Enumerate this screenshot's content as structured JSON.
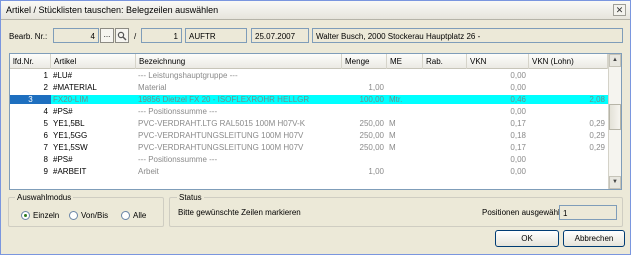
{
  "window": {
    "title": "Artikel / Stücklisten tauschen: Belegzeilen auswählen",
    "close_glyph": "✕"
  },
  "header": {
    "bearb_label": "Bearb. Nr.:",
    "bearb_nr": "4",
    "browse_glyph": "...",
    "search_icon": "magnifier-icon",
    "slash": "/",
    "pos_nr": "1",
    "beleg_type": "AUFTR",
    "date": "25.07.2007",
    "customer": "Walter Busch, 2000  Stockerau Hauptplatz 26 -"
  },
  "table": {
    "columns": [
      "lfd.Nr.",
      "Artikel",
      "Bezeichnung",
      "Menge",
      "ME",
      "Rab.",
      "VKN",
      "VKN (Lohn)"
    ],
    "rows": [
      {
        "nr": "1",
        "artikel": "#LU#",
        "bez": "--- Leistungshauptgruppe ---",
        "menge": "",
        "me": "",
        "rab": "",
        "vkn": "0,00",
        "lohn": "",
        "selected": false
      },
      {
        "nr": "2",
        "artikel": "#MATERIAL",
        "bez": "Material",
        "menge": "1,00",
        "me": "",
        "rab": "",
        "vkn": "0,00",
        "lohn": "",
        "selected": false
      },
      {
        "nr": "3",
        "artikel": "FX20-LIM",
        "bez": "19856 Dietzel FX 20 - ISOFLEXROHR HELLGR",
        "menge": "100,00",
        "me": "Mtr.",
        "rab": "",
        "vkn": "0,46",
        "lohn": "2,08",
        "selected": true
      },
      {
        "nr": "4",
        "artikel": "#PS#",
        "bez": "--- Positionssumme ---",
        "menge": "",
        "me": "",
        "rab": "",
        "vkn": "0,00",
        "lohn": "",
        "selected": false
      },
      {
        "nr": "5",
        "artikel": "YE1,5BL",
        "bez": "PVC-VERDRAHT.LTG RAL5015  100M H07V-K",
        "menge": "250,00",
        "me": "M",
        "rab": "",
        "vkn": "0,17",
        "lohn": "0,29",
        "selected": false
      },
      {
        "nr": "6",
        "artikel": "YE1,5GG",
        "bez": "PVC-VERDRAHTUNGSLEITUNG  100M H07V",
        "menge": "250,00",
        "me": "M",
        "rab": "",
        "vkn": "0,18",
        "lohn": "0,29",
        "selected": false
      },
      {
        "nr": "7",
        "artikel": "YE1,5SW",
        "bez": "PVC-VERDRAHTUNGSLEITUNG  100M H07V",
        "menge": "250,00",
        "me": "M",
        "rab": "",
        "vkn": "0,17",
        "lohn": "0,29",
        "selected": false
      },
      {
        "nr": "8",
        "artikel": "#PS#",
        "bez": "--- Positionssumme ---",
        "menge": "",
        "me": "",
        "rab": "",
        "vkn": "0,00",
        "lohn": "",
        "selected": false
      },
      {
        "nr": "9",
        "artikel": "#ARBEIT",
        "bez": "Arbeit",
        "menge": "1,00",
        "me": "",
        "rab": "",
        "vkn": "0,00",
        "lohn": "",
        "selected": false
      }
    ]
  },
  "auswahlmodus": {
    "label": "Auswahlmodus",
    "options": [
      "Einzeln",
      "Von/Bis",
      "Alle"
    ],
    "selected": "Einzeln"
  },
  "status": {
    "label": "Status",
    "message": "Bitte gewünschte Zeilen markieren",
    "count_label": "Positionen ausgewählt:",
    "count": "1"
  },
  "buttons": {
    "ok": "OK",
    "cancel": "Abbrechen"
  }
}
